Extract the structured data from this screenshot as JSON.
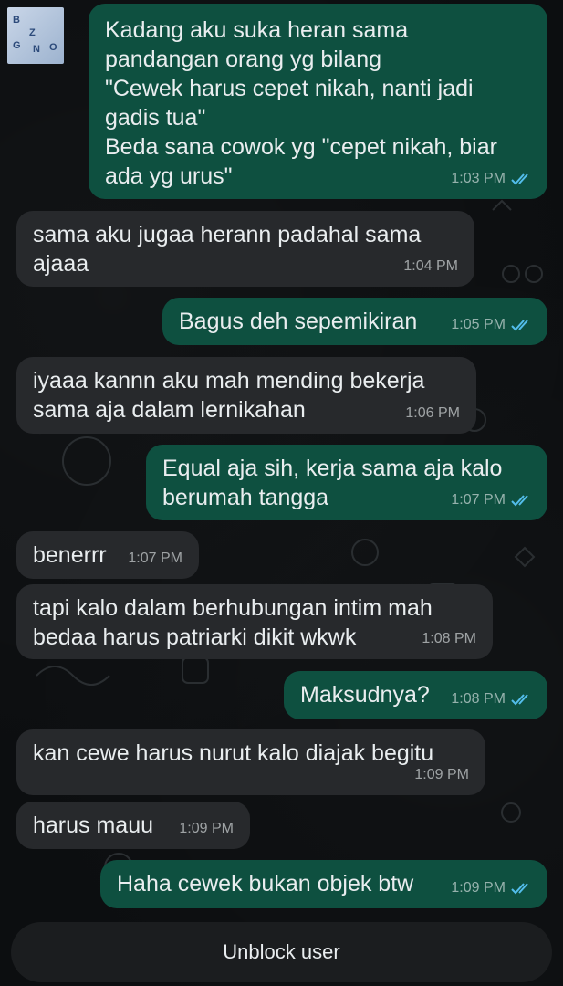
{
  "chat": {
    "messages": [
      {
        "dir": "out",
        "text": "Kadang aku suka heran sama\npandangan orang yg bilang\n\"Cewek harus cepet nikah, nanti jadi\ngadis tua\"\nBeda sana cowok yg \"cepet nikah, biar\nada yg urus\"",
        "time": "1:03 PM",
        "read": true
      },
      {
        "dir": "in",
        "text": "sama aku jugaa herann padahal sama\najaaa",
        "time": "1:04 PM"
      },
      {
        "dir": "out",
        "text": "Bagus deh sepemikiran",
        "time": "1:05 PM",
        "read": true
      },
      {
        "dir": "in",
        "text": "iyaaa kannn aku mah mending bekerja\nsama aja dalam lernikahan",
        "time": "1:06 PM"
      },
      {
        "dir": "out",
        "text": "Equal aja sih, kerja sama aja kalo\nberumah tangga",
        "time": "1:07 PM",
        "read": true
      },
      {
        "dir": "in",
        "text": "benerrr",
        "time": "1:07 PM"
      },
      {
        "dir": "in",
        "text": "tapi kalo dalam berhubungan intim mah\nbedaa harus patriarki dikit wkwk",
        "time": "1:08 PM"
      },
      {
        "dir": "out",
        "text": "Maksudnya?",
        "time": "1:08 PM",
        "read": true
      },
      {
        "dir": "in",
        "text": "kan cewe harus nurut kalo diajak begitu",
        "time": "1:09 PM"
      },
      {
        "dir": "in",
        "text": "harus mauu",
        "time": "1:09 PM"
      },
      {
        "dir": "out",
        "text": "Haha cewek bukan objek btw",
        "time": "1:09 PM",
        "read": true
      }
    ],
    "avatar_text": "BOZ GNO",
    "unblock_label": "Unblock user",
    "colors": {
      "outgoing": "#0e5040",
      "incoming": "#27292c",
      "read_tick": "#53bdeb"
    }
  }
}
